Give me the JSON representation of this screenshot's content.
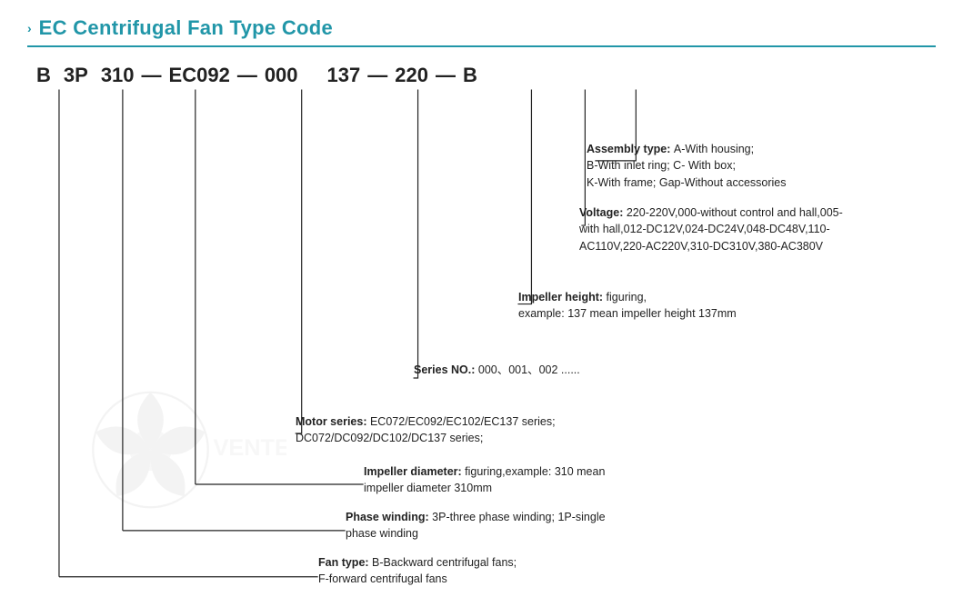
{
  "title": {
    "chevron": "›",
    "text": "EC Centrifugal Fan Type Code"
  },
  "code": {
    "segments": [
      "B",
      "3P",
      "310",
      "EC092",
      "000",
      "137",
      "220",
      "B"
    ],
    "dashes": [
      "—",
      "—",
      "—",
      "—",
      "—",
      "—"
    ]
  },
  "annotations": {
    "assembly": {
      "label": "Assembly type:",
      "text": "A-With housing;\nB-With inlet ring;  C- With box;\nK-With frame; Gap-Without accessories"
    },
    "voltage": {
      "label": "Voltage:",
      "text": "220-220V,000-without control and hall,005-with hall,012-DC12V,024-DC24V,048-DC48V,110-AC110V,220-AC220V,310-DC310V,380-AC380V"
    },
    "impeller_height": {
      "label": "Impeller height:",
      "text": "figuring,\nexample: 137 mean impeller height 137mm"
    },
    "series": {
      "label": "Series NO.:",
      "text": "000、001、002 ......"
    },
    "motor": {
      "label": "Motor series:",
      "text": "EC072/EC092/EC102/EC137 series;\nDC072/DC092/DC102/DC137 series;"
    },
    "impeller_dia": {
      "label": "Impeller diameter:",
      "text": "figuring,example: 310 mean\nimpeller diameter 310mm"
    },
    "phase": {
      "label": "Phase winding:",
      "text": "3P-three phase winding;  1P-single\nphase winding"
    },
    "fan_type": {
      "label": "Fan type:",
      "text": "B-Backward centrifugal fans;\nF-forward centrifugal fans"
    }
  }
}
